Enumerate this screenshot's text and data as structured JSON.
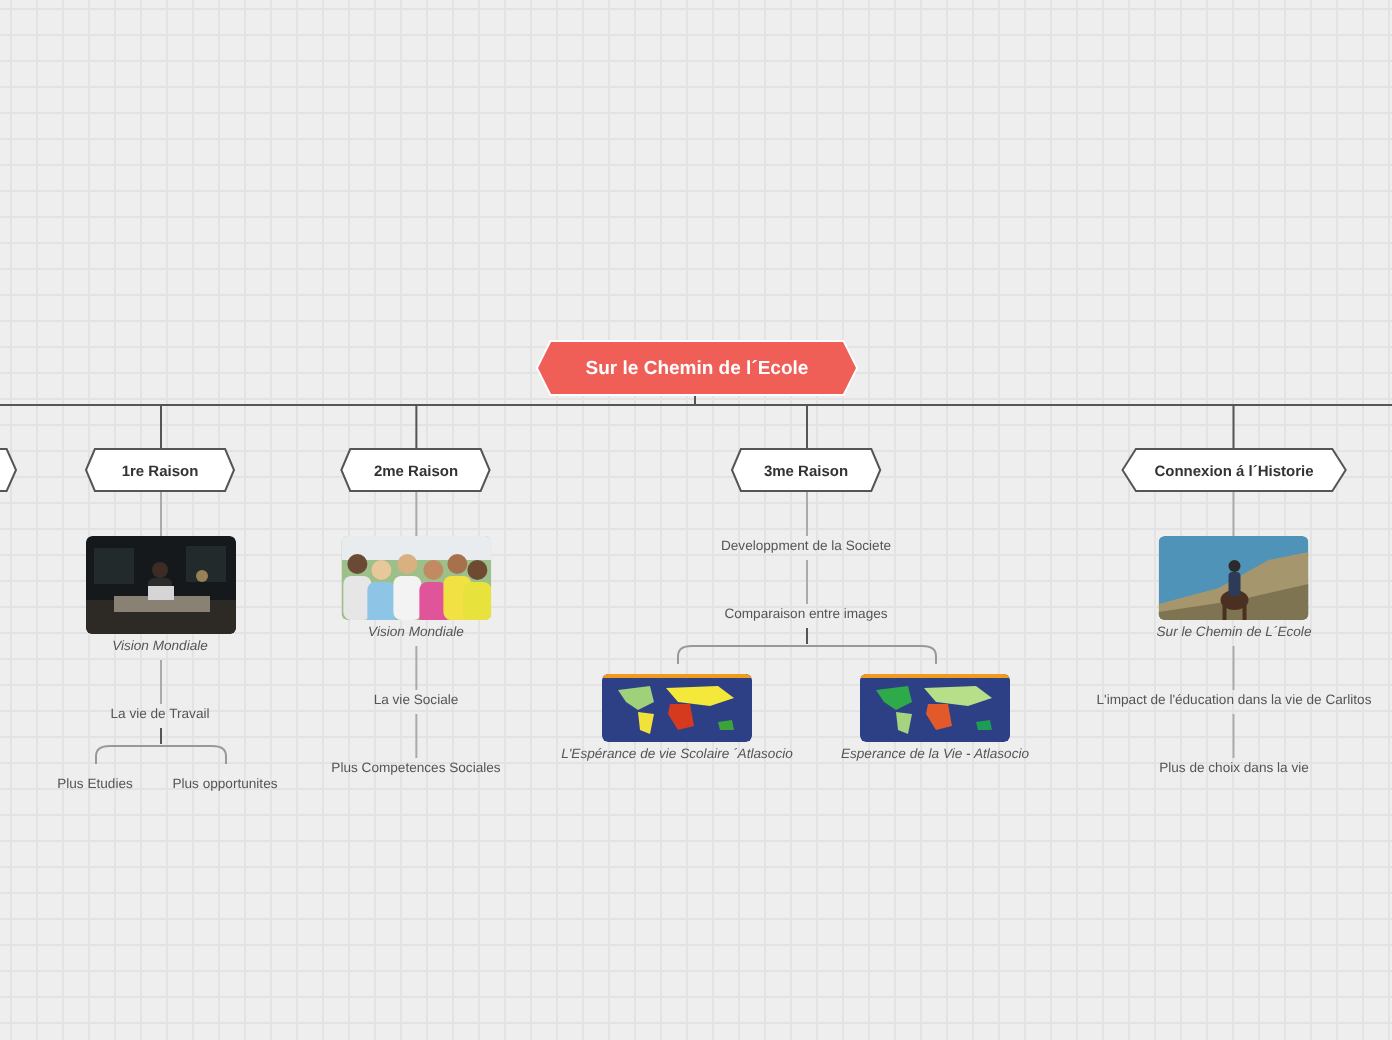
{
  "root": {
    "label": "Sur le Chemin de l´Ecole"
  },
  "partial_left_topic": true,
  "branches": [
    {
      "label": "1re Raison",
      "children": [
        {
          "kind": "picture",
          "caption": "Vision Mondiale",
          "children": [
            {
              "kind": "text",
              "label": "La vie de Travail",
              "children": [
                {
                  "kind": "text",
                  "label": "Plus Etudies"
                },
                {
                  "kind": "text",
                  "label": "Plus opportunites"
                }
              ]
            }
          ]
        }
      ]
    },
    {
      "label": "2me Raison",
      "children": [
        {
          "kind": "picture",
          "caption": "Vision Mondiale",
          "children": [
            {
              "kind": "text",
              "label": "La vie Sociale",
              "children": [
                {
                  "kind": "text",
                  "label": "Plus Competences Sociales"
                }
              ]
            }
          ]
        }
      ]
    },
    {
      "label": "3me Raison",
      "children": [
        {
          "kind": "text",
          "label": "Developpment de la Societe",
          "children": [
            {
              "kind": "text",
              "label": "Comparaison entre images",
              "children": [
                {
                  "kind": "picture",
                  "caption": "L'Espérance de vie Scolaire ´Atlasocio"
                },
                {
                  "kind": "picture",
                  "caption": "Esperance de la Vie - Atlasocio"
                }
              ]
            }
          ]
        }
      ]
    },
    {
      "label": "Connexion á l´Historie",
      "children": [
        {
          "kind": "picture",
          "caption": "Sur le Chemin de L´Ecole",
          "children": [
            {
              "kind": "text",
              "label": "L'impact de l'éducation dans la vie de Carlitos",
              "children": [
                {
                  "kind": "text",
                  "label": "Plus de choix dans la vie"
                }
              ]
            }
          ]
        }
      ]
    }
  ]
}
